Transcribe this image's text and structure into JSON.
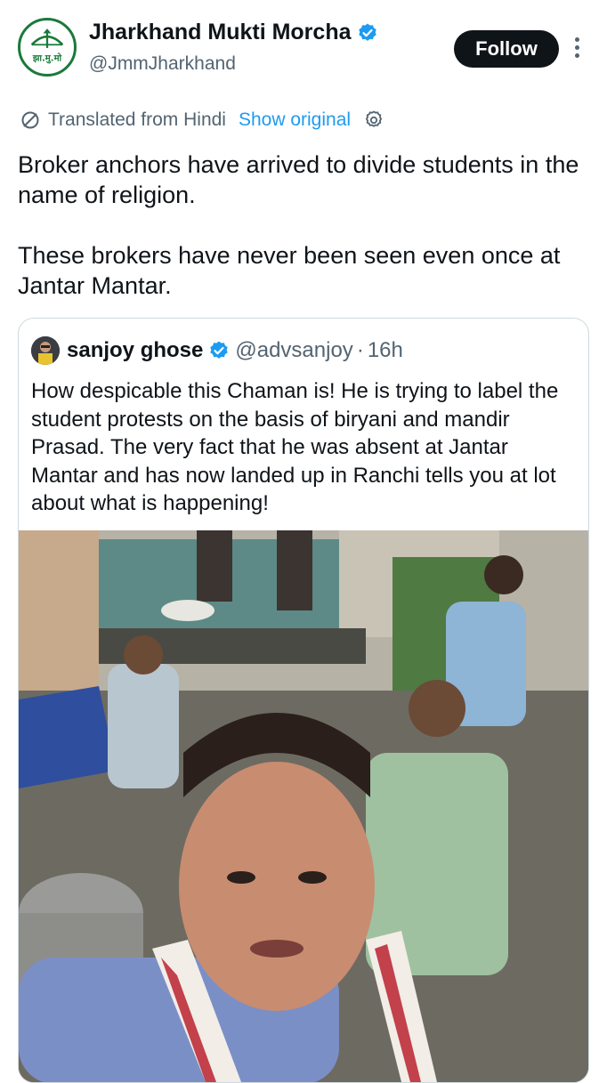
{
  "account": {
    "name": "Jharkhand Mukti Morcha",
    "handle": "@JmmJharkhand",
    "avatar_logo_text": "झा.मु.मो",
    "follow_label": "Follow"
  },
  "translation": {
    "notice": "Translated from Hindi",
    "show_original": "Show original"
  },
  "tweet": {
    "paragraph_1": "Broker anchors have arrived to divide students in the name of religion.",
    "paragraph_2": "These brokers have never been seen even once at Jantar Mantar."
  },
  "quoted": {
    "name": "sanjoy ghose",
    "handle": "@advsanjoy",
    "separator": "·",
    "time": "16h",
    "text": "How despicable this Chaman is! He is trying to label the student protests on the basis of biryani and mandir Prasad.  The very fact that he was absent at Jantar Mantar and has now landed up in Ranchi tells you at lot about what is happening!"
  },
  "colors": {
    "accent": "#1d9bf0",
    "text_primary": "#0f1419",
    "text_secondary": "#536471",
    "follow_bg": "#0f1419",
    "logo_green": "#1a7a3a"
  },
  "icons": [
    "verified-badge-icon",
    "more-options-icon",
    "translate-icon",
    "gear-icon"
  ]
}
